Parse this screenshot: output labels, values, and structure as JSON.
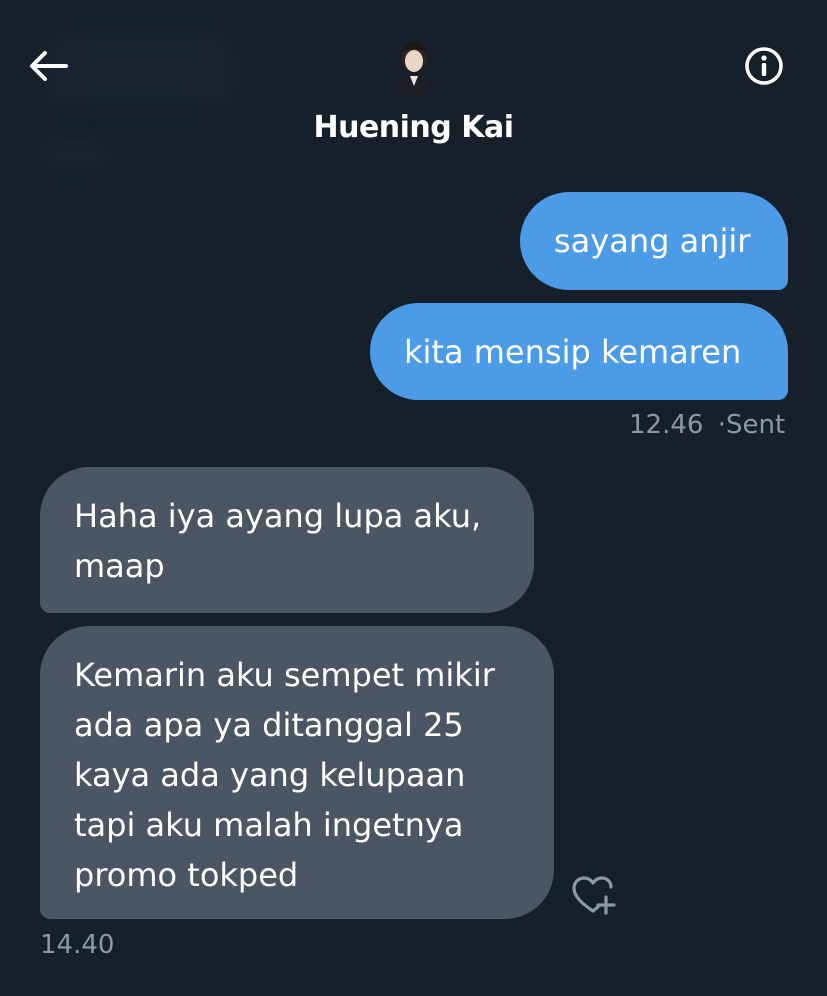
{
  "header": {
    "contact_name": "Huening Kai",
    "back_icon": "arrow-left-icon",
    "info_icon": "info-circle-icon",
    "avatar": "profile-avatar"
  },
  "messages": [
    {
      "direction": "sent",
      "text": "sayang anjir"
    },
    {
      "direction": "sent",
      "text": "kita mensip kemaren"
    },
    {
      "direction": "received",
      "text": "Haha iya ayang lupa aku,\nmaap"
    },
    {
      "direction": "received",
      "text": "Kemarin aku sempet mikir\nada apa ya ditanggal 25\nkaya ada yang kelupaan\ntapi aku malah ingetnya\npromo tokped"
    }
  ],
  "sent_meta": {
    "time": "12.46",
    "separator": "·",
    "status": "Sent"
  },
  "received_meta": {
    "time": "14.40"
  },
  "reaction_icon": "heart-add-icon",
  "colors": {
    "background": "#15202b",
    "sent_bubble": "#4b9be6",
    "received_bubble": "#4a5663",
    "meta_text": "#8b98a5"
  }
}
